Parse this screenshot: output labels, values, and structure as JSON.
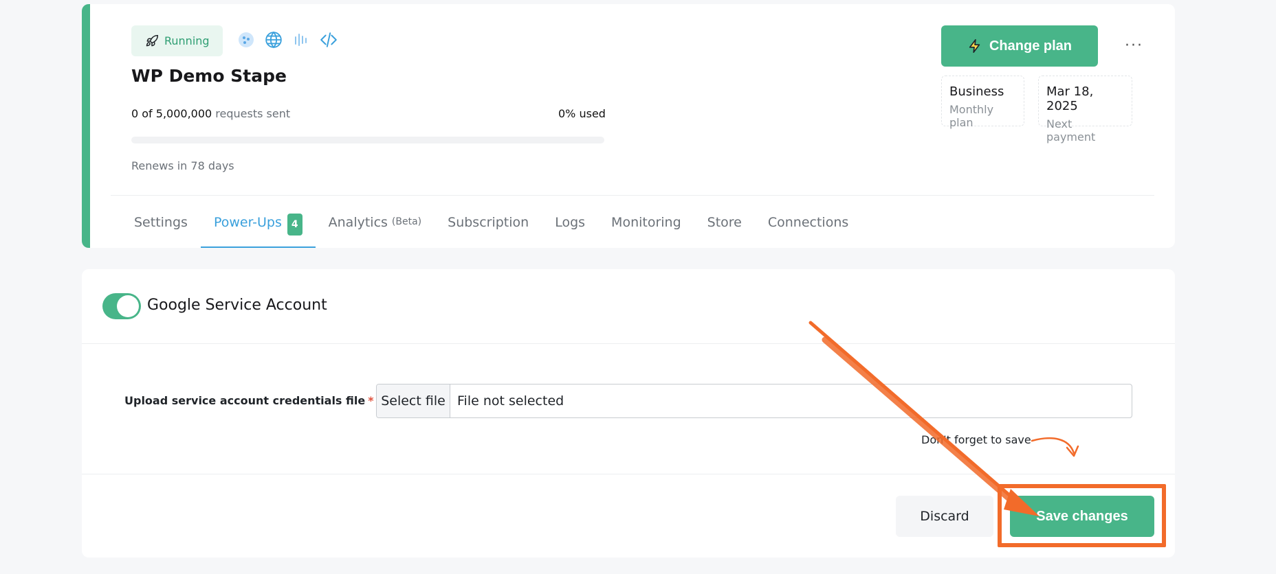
{
  "project": {
    "status": "Running",
    "name": "WP Demo Stape",
    "requests_count": "0 of 5,000,000",
    "requests_suffix": "requests sent",
    "used": "0% used",
    "usage_fraction": 0,
    "renews": "Renews in 78 days",
    "service_icons": [
      "gtm-dots-icon",
      "globe-icon",
      "audio-bars-icon",
      "code-icon"
    ]
  },
  "actions": {
    "change_plan": "Change plan",
    "more": "···"
  },
  "plan": {
    "name": "Business",
    "type": "Monthly plan",
    "payment_date": "Mar 18, 2025",
    "payment_label": "Next payment"
  },
  "tabs": [
    {
      "label": "Settings"
    },
    {
      "label": "Power-Ups",
      "badge": "4",
      "active": true
    },
    {
      "label": "Analytics",
      "suffix": "(Beta)"
    },
    {
      "label": "Subscription"
    },
    {
      "label": "Logs"
    },
    {
      "label": "Monitoring"
    },
    {
      "label": "Store"
    },
    {
      "label": "Connections"
    }
  ],
  "powerup": {
    "title": "Google Service Account",
    "enabled": true,
    "upload_label": "Upload service account credentials file",
    "required_mark": "*",
    "select_file": "Select file",
    "file_value": "File not selected",
    "reminder": "Don't forget to save",
    "discard": "Discard",
    "save": "Save changes"
  },
  "colors": {
    "accent": "#48b589",
    "tab_active": "#3aa0dc",
    "annotation": "#f26b2a"
  }
}
